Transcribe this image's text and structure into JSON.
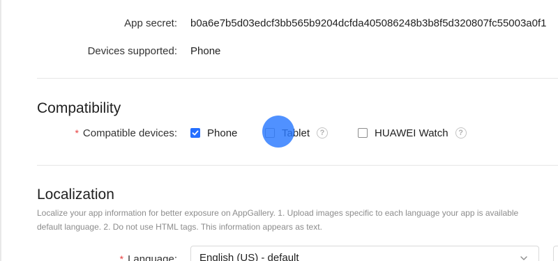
{
  "app_info": {
    "app_secret_label": "App secret:",
    "app_secret_value": "b0a6e7b5d03edcf3bb565b9204dcfda405086248b3b8f5d320807fc55003a0f1",
    "devices_label": "Devices supported:",
    "devices_value": "Phone"
  },
  "compatibility": {
    "title": "Compatibility",
    "label": "Compatible devices:",
    "options": [
      {
        "label": "Phone",
        "checked": true
      },
      {
        "label": "Tablet",
        "checked": false
      },
      {
        "label": "HUAWEI Watch",
        "checked": false
      }
    ]
  },
  "localization": {
    "title": "Localization",
    "description_line1": "Localize your app information for better exposure on AppGallery. 1. Upload images specific to each language your app is available",
    "description_line2": "default language. 2. Do not use HTML tags. This information appears as text.",
    "language_label": "Language:",
    "language_value": "English (US) - default"
  },
  "colors": {
    "accent": "#256fff",
    "required": "#e84040",
    "touch_indicator": "#2979ff"
  },
  "icons": {
    "help": "question-circle-icon",
    "dropdown": "chevron-down-icon",
    "check": "check-icon"
  }
}
